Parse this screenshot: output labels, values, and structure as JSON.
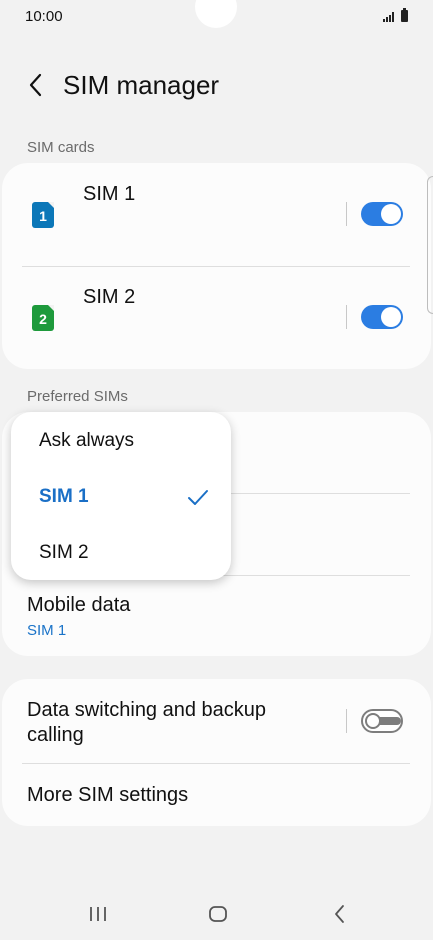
{
  "status_bar": {
    "time": "10:00"
  },
  "header": {
    "title": "SIM manager"
  },
  "sim_cards": {
    "section_label": "SIM cards",
    "items": [
      {
        "name": "SIM 1",
        "icon_number": "1",
        "icon_color": "#0c77b8",
        "enabled": true
      },
      {
        "name": "SIM 2",
        "icon_number": "2",
        "icon_color": "#1e9a3c",
        "enabled": true
      }
    ]
  },
  "preferred_sims": {
    "section_label": "Preferred SIMs",
    "mobile_data": {
      "title": "Mobile data",
      "value": "SIM 1"
    }
  },
  "popup_menu": {
    "options": [
      "Ask always",
      "SIM 1",
      "SIM 2"
    ],
    "selected": "SIM 1"
  },
  "other_settings": {
    "data_switching": {
      "title_line1": "Data switching and backup",
      "title_line2": "calling",
      "enabled": false
    },
    "more_settings": {
      "title": "More SIM settings"
    }
  },
  "colors": {
    "accent": "#2b7de2",
    "link_blue": "#1a73c8",
    "background": "#f2f2f2"
  },
  "nav_bar": {
    "icons": [
      "recent-apps-icon",
      "home-icon",
      "back-icon"
    ]
  }
}
